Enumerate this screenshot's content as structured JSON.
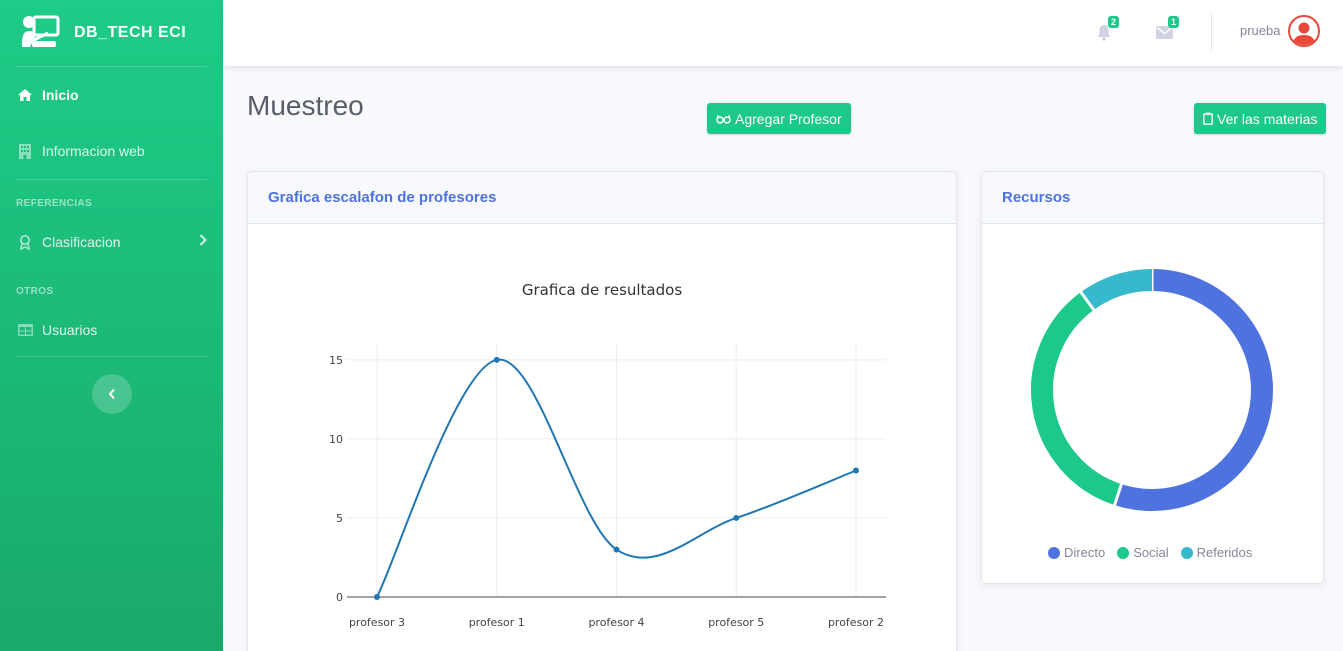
{
  "brand": {
    "name": "DB_TECH ECI"
  },
  "sidebar": {
    "items": [
      {
        "label": "Inicio",
        "icon": "home-icon",
        "active": true
      },
      {
        "label": "Informacion web",
        "icon": "building-icon"
      }
    ],
    "sections": [
      {
        "heading": "REFERENCIAS",
        "items": [
          {
            "label": "Clasificacion",
            "icon": "award-icon"
          }
        ]
      },
      {
        "heading": "OTROS",
        "items": [
          {
            "label": "Usuarios",
            "icon": "table-icon"
          }
        ]
      }
    ],
    "toggle_icon": "chevron-left-icon"
  },
  "topbar": {
    "alerts_count": "2",
    "messages_count": "1",
    "user_name": "prueba"
  },
  "page": {
    "title": "Muestreo",
    "add_teacher_button": "Agregar Profesor",
    "view_subjects_button": "Ver las materias"
  },
  "colors": {
    "primary": "#1cc88a",
    "header_text": "#4e73df",
    "line": "#1f77b4",
    "directo": "#4e73df",
    "social": "#1cc88a",
    "referidos": "#36b9cc"
  },
  "line_card": {
    "header": "Grafica escalafon de profesores"
  },
  "donut_card": {
    "header": "Recursos"
  },
  "chart_data": [
    {
      "type": "line",
      "title": "Grafica de resultados",
      "categories": [
        "profesor 3",
        "profesor 1",
        "profesor 4",
        "profesor 5",
        "profesor 2"
      ],
      "values": [
        0,
        15,
        3,
        5,
        8
      ],
      "ylim": [
        0,
        16
      ],
      "yticks": [
        0,
        5,
        10,
        15
      ],
      "grid": true,
      "smooth": true
    },
    {
      "type": "pie",
      "donut": true,
      "labels": [
        "Directo",
        "Social",
        "Referidos"
      ],
      "values": [
        55,
        35,
        10
      ],
      "colors": [
        "#4e73df",
        "#1cc88a",
        "#36b9cc"
      ],
      "legend": "bottom"
    }
  ]
}
